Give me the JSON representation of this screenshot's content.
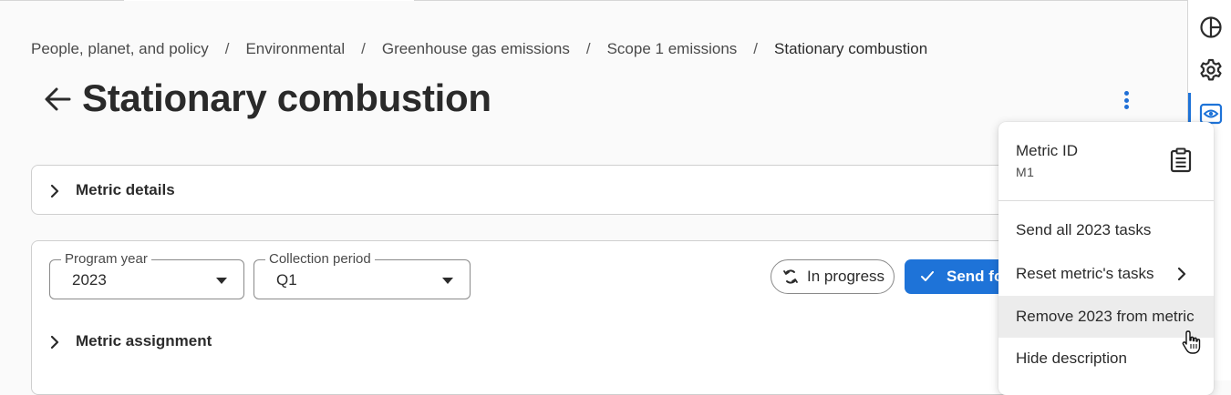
{
  "breadcrumb": [
    {
      "label": "People, planet, and policy"
    },
    {
      "label": "Environmental"
    },
    {
      "label": "Greenhouse gas emissions"
    },
    {
      "label": "Scope 1 emissions"
    },
    {
      "label": "Stationary combustion"
    }
  ],
  "breadcrumb_separator": "/",
  "page": {
    "title": "Stationary combustion",
    "back_icon": "arrow-left-icon",
    "more_icon": "kebab-vertical-icon"
  },
  "metric_details": {
    "label": "Metric details"
  },
  "filters": {
    "program_year": {
      "label": "Program year",
      "value": "2023"
    },
    "collection_period": {
      "label": "Collection period",
      "value": "Q1"
    }
  },
  "status": {
    "label": "In progress",
    "icon": "refresh-icon"
  },
  "send_button": {
    "label": "Send fo"
  },
  "metric_assignment": {
    "label": "Metric assignment"
  },
  "menu": {
    "header_label": "Metric ID",
    "header_value": "M1",
    "copy_icon": "clipboard-icon",
    "items": [
      {
        "label": "Send all 2023 tasks"
      },
      {
        "label": "Reset metric's tasks",
        "has_submenu": true
      },
      {
        "label": "Remove 2023 from metric",
        "hovered": true
      },
      {
        "label": "Hide description"
      }
    ]
  },
  "rail": {
    "icons": [
      "pie-chart-icon",
      "gear-icon",
      "eye-icon"
    ],
    "active": "eye-icon"
  },
  "colors": {
    "accent": "#1e73d8",
    "text": "#2b2b2b",
    "border": "#cfcfcf",
    "hover": "#ececec"
  }
}
